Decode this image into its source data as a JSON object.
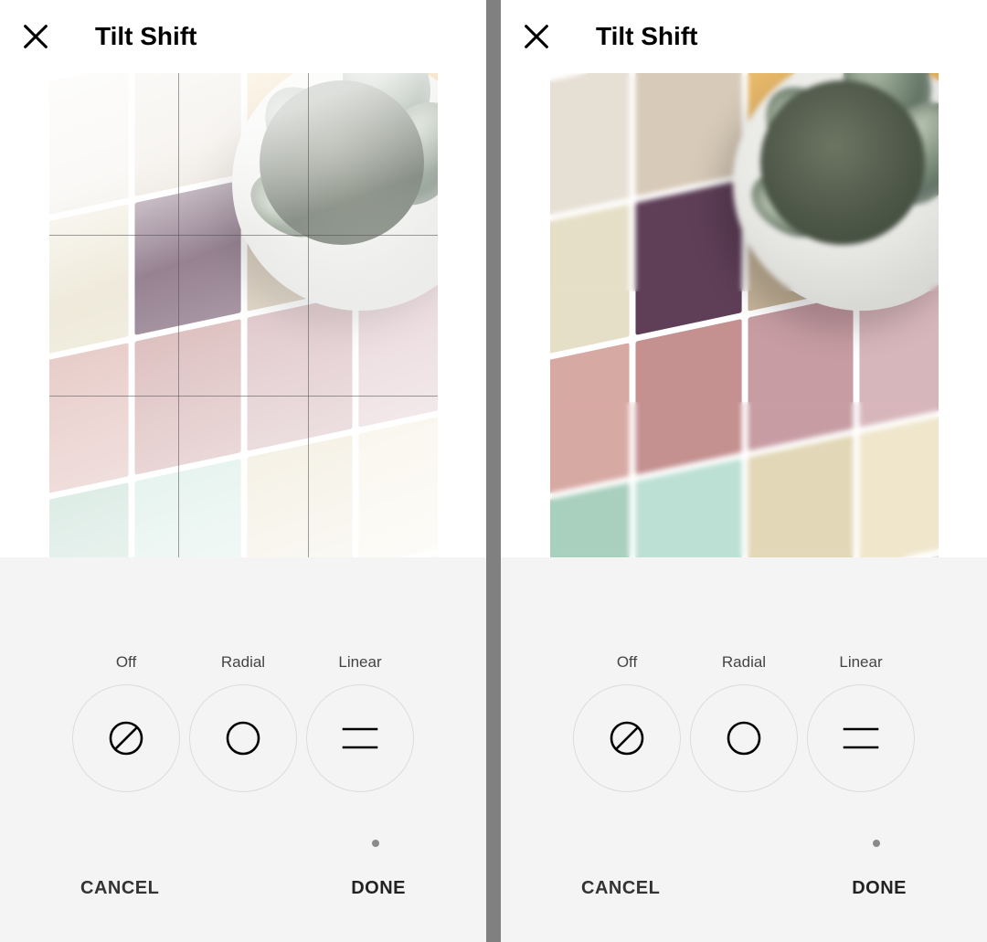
{
  "left": {
    "title": "Tilt Shift",
    "options": {
      "off": "Off",
      "radial": "Radial",
      "linear": "Linear"
    },
    "footer": {
      "cancel": "CANCEL",
      "done": "DONE"
    }
  },
  "right": {
    "title": "Tilt Shift",
    "options": {
      "off": "Off",
      "radial": "Radial",
      "linear": "Linear"
    },
    "footer": {
      "cancel": "CANCEL",
      "done": "DONE"
    }
  },
  "tileColors": {
    "r1": [
      "#e6dfd4",
      "#d7cab8",
      "#e8b96a",
      "#e3a84e"
    ],
    "r2": [
      "#e6dfc7",
      "#5f3f58",
      "#c6b49a",
      "#b8a88c"
    ],
    "r3": [
      "#d7a9a3",
      "#c49090",
      "#c79da3",
      "#d7b6bb"
    ],
    "r4": [
      "#a9cfbf",
      "#bde0d4",
      "#e2d7b7",
      "#efe6cc"
    ],
    "r5": [
      "#f0ede2",
      "#e9e4d2",
      "#d9e9de",
      "#c7dfd0"
    ]
  }
}
